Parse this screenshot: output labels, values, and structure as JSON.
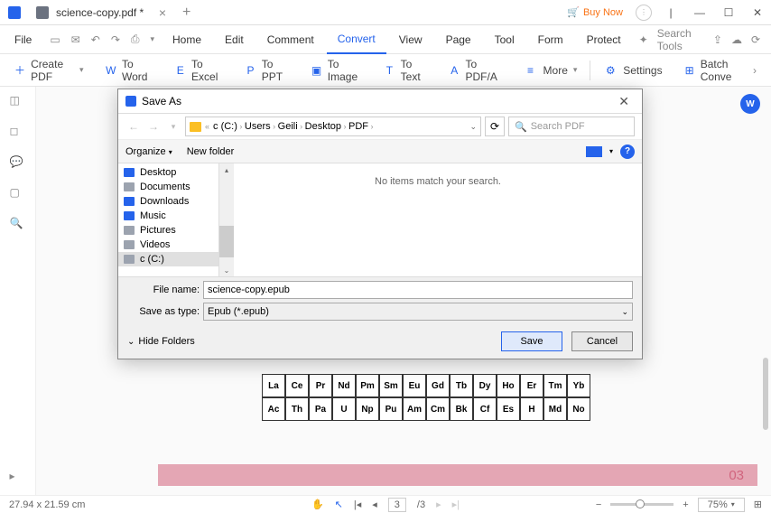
{
  "titlebar": {
    "tab_title": "science-copy.pdf *",
    "buy_now": "Buy Now"
  },
  "menubar": {
    "file": "File",
    "items": [
      "Home",
      "Edit",
      "Comment",
      "Convert",
      "View",
      "Page",
      "Tool",
      "Form",
      "Protect"
    ],
    "active_index": 3,
    "search_placeholder": "Search Tools"
  },
  "toolbar": {
    "create_pdf": "Create PDF",
    "to_word": "To Word",
    "to_excel": "To Excel",
    "to_ppt": "To PPT",
    "to_image": "To Image",
    "to_text": "To Text",
    "to_pdfa": "To PDF/A",
    "more": "More",
    "settings": "Settings",
    "batch_convert": "Batch Conve"
  },
  "status": {
    "dimensions": "27.94 x 21.59 cm",
    "page": "3",
    "page_total": "/3",
    "zoom": "75%"
  },
  "doc": {
    "page_number": "03",
    "row1": [
      "La",
      "Ce",
      "Pr",
      "Nd",
      "Pm",
      "Sm",
      "Eu",
      "Gd",
      "Tb",
      "Dy",
      "Ho",
      "Er",
      "Tm",
      "Yb"
    ],
    "row2": [
      "Ac",
      "Th",
      "Pa",
      "U",
      "Np",
      "Pu",
      "Am",
      "Cm",
      "Bk",
      "Cf",
      "Es",
      "H",
      "Md",
      "No"
    ]
  },
  "dialog": {
    "title": "Save As",
    "path": [
      "c (C:)",
      "Users",
      "Geili",
      "Desktop",
      "PDF"
    ],
    "search_placeholder": "Search PDF",
    "organize": "Organize",
    "new_folder": "New folder",
    "tree": [
      {
        "label": "Desktop",
        "color": "#2563eb"
      },
      {
        "label": "Documents",
        "color": "#9ca3af"
      },
      {
        "label": "Downloads",
        "color": "#2563eb"
      },
      {
        "label": "Music",
        "color": "#2563eb"
      },
      {
        "label": "Pictures",
        "color": "#9ca3af"
      },
      {
        "label": "Videos",
        "color": "#9ca3af"
      },
      {
        "label": "c (C:)",
        "color": "#9ca3af"
      }
    ],
    "tree_selected_index": 6,
    "empty_msg": "No items match your search.",
    "filename_label": "File name:",
    "filename_value": "science-copy.epub",
    "savetype_label": "Save as type:",
    "savetype_value": "Epub (*.epub)",
    "hide_folders": "Hide Folders",
    "save": "Save",
    "cancel": "Cancel"
  }
}
